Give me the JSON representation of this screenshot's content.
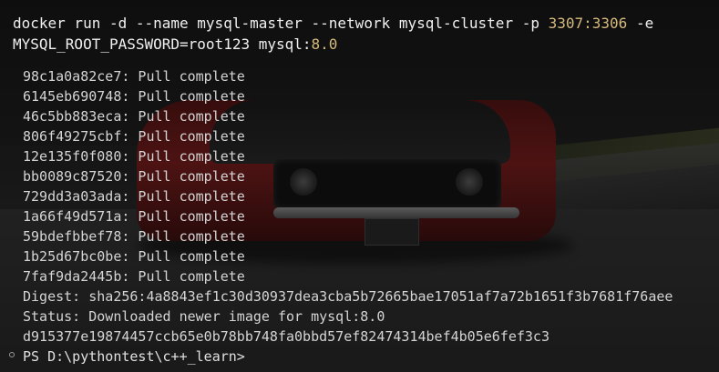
{
  "command": {
    "part1": "docker run -d --name mysql-master --network mysql-cluster -p ",
    "port_host": "3307",
    "colon": ":",
    "port_container": "3306",
    "part2": " -e",
    "line2_pre": "MYSQL_ROOT_PASSWORD=root123 mysql:",
    "version": "8.0"
  },
  "pull_lines": [
    "98c1a0a82ce7: Pull complete",
    "6145eb690748: Pull complete",
    "46c5bb883eca: Pull complete",
    "806f49275cbf: Pull complete",
    "12e135f0f080: Pull complete",
    "bb0089c87520: Pull complete",
    "729dd3a03ada: Pull complete",
    "1a66f49d571a: Pull complete",
    "59bdefbbef78: Pull complete",
    "1b25d67bc0be: Pull complete",
    "7faf9da2445b: Pull complete"
  ],
  "digest": "Digest: sha256:4a8843ef1c30d30937dea3cba5b72665bae17051af7a72b1651f3b7681f76aee",
  "status": "Status: Downloaded newer image for mysql:8.0",
  "container_id": "d915377e19874457ccb65e0b78bb748fa0bbd57ef82474314bef4b05e6fef3c3",
  "prompt": "PS D:\\pythontest\\c++_learn>",
  "colors": {
    "number_highlight": "#d7ba7d",
    "text": "#d4d4d4"
  }
}
